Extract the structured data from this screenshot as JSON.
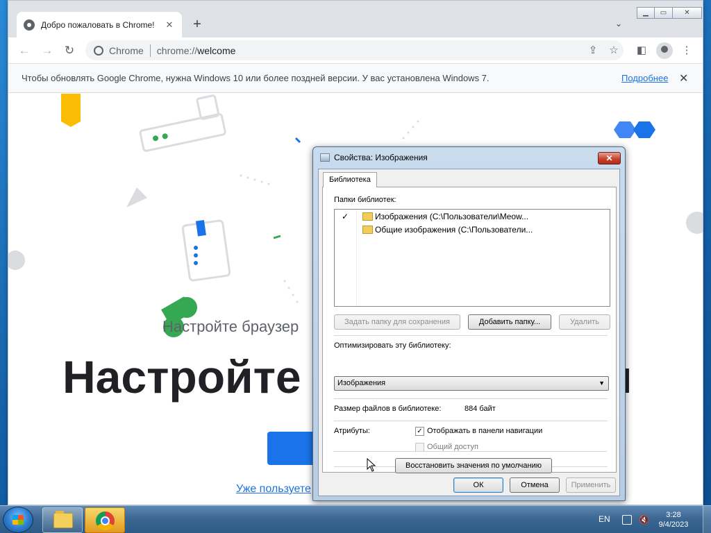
{
  "chrome": {
    "tab_title": "Добро пожаловать в Chrome!",
    "tab_close": "✕",
    "new_tab": "+",
    "tab_search": "⌄",
    "omnibox_chip": "Chrome",
    "url_prefix": "chrome://",
    "url_host": "welcome",
    "infobar_text": "Чтобы обновлять Google Chrome, нужна Windows 10 или более поздней версии. У вас установлена Windows 7.",
    "infobar_link": "Подробнее",
    "infobar_close": "✕",
    "page_subtitle": "Настройте браузер",
    "page_title_left": "Настройте С",
    "page_title_right": "я",
    "page_already_link": "Уже пользуете"
  },
  "dialog": {
    "title": "Свойства: Изображения",
    "close": "✕",
    "tab": "Библиотека",
    "folders_label": "Папки библиотек:",
    "folders": [
      {
        "checked": "✓",
        "text": "Изображения (C:\\Пользователи\\Meow..."
      },
      {
        "checked": "",
        "text": "Общие изображения (C:\\Пользователи..."
      }
    ],
    "btn_set_save": "Задать папку для сохранения",
    "btn_add_folder": "Добавить папку...",
    "btn_remove": "Удалить",
    "optimize_label": "Оптимизировать эту библиотеку:",
    "optimize_value": "Изображения",
    "size_label": "Размер файлов в библиотеке:",
    "size_value": "884 байт",
    "attributes_label": "Атрибуты:",
    "attr_nav": "Отображать в панели навигации",
    "attr_nav_checked": "✓",
    "attr_share": "Общий доступ",
    "btn_restore": "Восстановить значения по умолчанию",
    "btn_ok": "ОК",
    "btn_cancel": "Отмена",
    "btn_apply": "Применить"
  },
  "taskbar": {
    "lang": "EN",
    "time": "3:28",
    "date": "9/4/2023"
  }
}
